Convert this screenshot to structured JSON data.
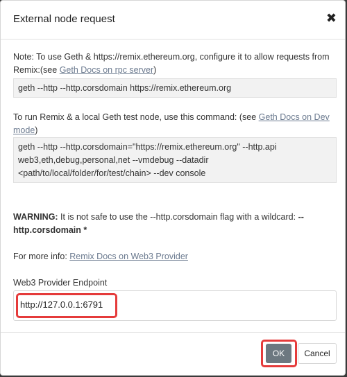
{
  "modal": {
    "title": "External node request",
    "close_glyph": "✖"
  },
  "note": {
    "text": "Note: To use Geth & https://remix.ethereum.org, configure it to allow requests from Remix:(see ",
    "link": "Geth Docs on rpc server",
    "suffix": ")"
  },
  "cmd1": "geth --http --http.corsdomain https://remix.ethereum.org",
  "run_note": {
    "text": "To run Remix & a local Geth test node, use this command: (see ",
    "link": "Geth Docs on Dev mode",
    "suffix": ")"
  },
  "cmd2": {
    "line1": "geth --http --http.corsdomain=\"https://remix.ethereum.org\" --http.api",
    "line2": "web3,eth,debug,personal,net --vmdebug --datadir",
    "line3": "<path/to/local/folder/for/test/chain> --dev console"
  },
  "warning": {
    "label": "WARNING:",
    "text": " It is not safe to use the --http.corsdomain flag with a wildcard: ",
    "flag": "--http.corsdomain *"
  },
  "more_info": {
    "text": "For more info: ",
    "link": "Remix Docs on Web3 Provider"
  },
  "endpoint": {
    "label": "Web3 Provider Endpoint",
    "value": "http://127.0.0.1:6791"
  },
  "footer": {
    "ok_label": "OK",
    "cancel_label": "Cancel"
  },
  "colors": {
    "highlight": "#e53b3b",
    "ok_button": "#6d7880",
    "link": "#6b7a8f"
  }
}
